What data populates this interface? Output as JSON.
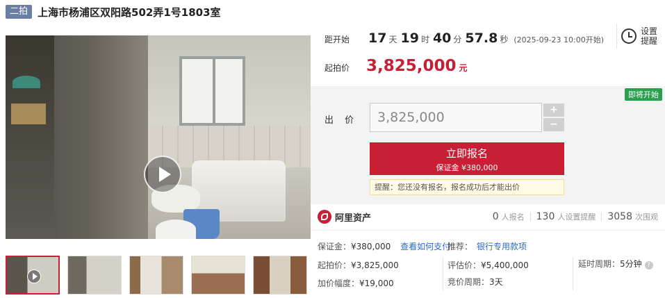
{
  "header": {
    "badge": "二拍",
    "title": "上海市杨浦区双阳路502弄1号1803室"
  },
  "countdown": {
    "label": "距开始",
    "days": "17",
    "days_unit": "天",
    "hours": "19",
    "hours_unit": "时",
    "minutes": "40",
    "minutes_unit": "分",
    "seconds": "57.8",
    "seconds_unit": "秒",
    "start_note": "(2025-09-23 10:00开始)"
  },
  "reminder": {
    "label": "设置提醒",
    "icon": "alarm-clock-icon"
  },
  "start_price": {
    "label": "起拍价",
    "value": "3,825,000",
    "unit": "元"
  },
  "bid": {
    "status": "即将开始",
    "label": "出 价",
    "input_value": "3,825,000",
    "plus": "+",
    "minus": "−",
    "signup_label": "立即报名",
    "deposit_label": "保证金 ¥380,000",
    "tip": "提醒：您还没有报名，报名成功后才能出价"
  },
  "platform": {
    "name": "阿里资产",
    "icon": "ali-asset-logo-icon",
    "stats": [
      {
        "num": "0",
        "label": "人报名"
      },
      {
        "num": "130",
        "label": "人设置提醒"
      },
      {
        "num": "3058",
        "label": "次围观"
      }
    ]
  },
  "info": {
    "deposit_k": "保证金：",
    "deposit_v": "¥380,000",
    "deposit_link": "查看如何支付",
    "recommend_k": "推荐：",
    "recommend_link": "银行专用款项",
    "start_price_k": "起拍价：",
    "start_price_v": "¥3,825,000",
    "appraisal_k": "评估价：",
    "appraisal_v": "¥5,400,000",
    "delay_k": "延时周期：",
    "delay_v": "5分钟",
    "increment_k": "加价幅度：",
    "increment_v": "¥19,000",
    "cycle_k": "竞价周期：",
    "cycle_v": "3天"
  },
  "colors": {
    "accent": "#c81f34",
    "status_green": "#2aa04f",
    "link": "#2a6ac7",
    "badge": "#6b7fa3"
  }
}
